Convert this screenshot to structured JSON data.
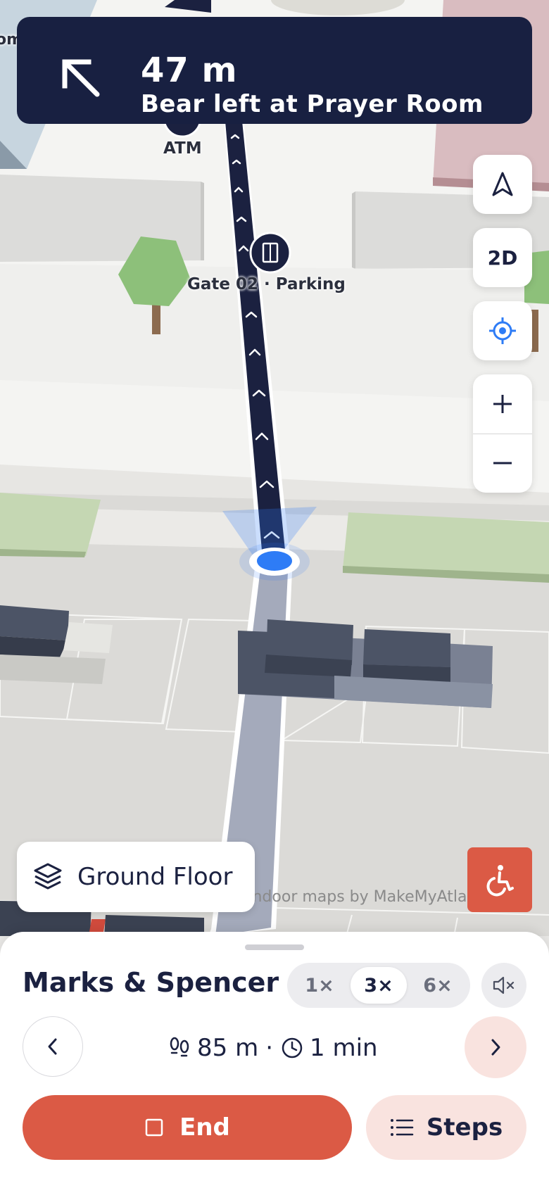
{
  "navigation": {
    "distance": "47 m",
    "instruction": "Bear left at Prayer Room",
    "direction_icon": "arrow-up-left-icon"
  },
  "map": {
    "poi_labels": {
      "atm": "ATM",
      "gate": "Gate 02 · Parking",
      "partial_left": "om"
    },
    "attribution": "Indoor maps by MakeMyAtlas",
    "floor_label": "Ground Floor",
    "view_mode_label": "2D",
    "icons": {
      "compass": "compass-arrow-icon",
      "locate": "crosshair-icon",
      "zoom_in": "plus-icon",
      "zoom_out": "minus-icon",
      "floors": "layers-icon",
      "accessibility": "wheelchair-icon",
      "gate": "door-icon"
    },
    "colors": {
      "route_active": "#1b2140",
      "route_inactive": "#a4aabb",
      "user_location": "#2e7cf6",
      "accent": "#db5a45"
    }
  },
  "sheet": {
    "destination": "Marks & Spencer",
    "speed_options": [
      "1×",
      "3×",
      "6×"
    ],
    "speed_selected": "3×",
    "distance": "85 m",
    "separator": "·",
    "duration": "1 min",
    "end_label": "End",
    "steps_label": "Steps"
  }
}
